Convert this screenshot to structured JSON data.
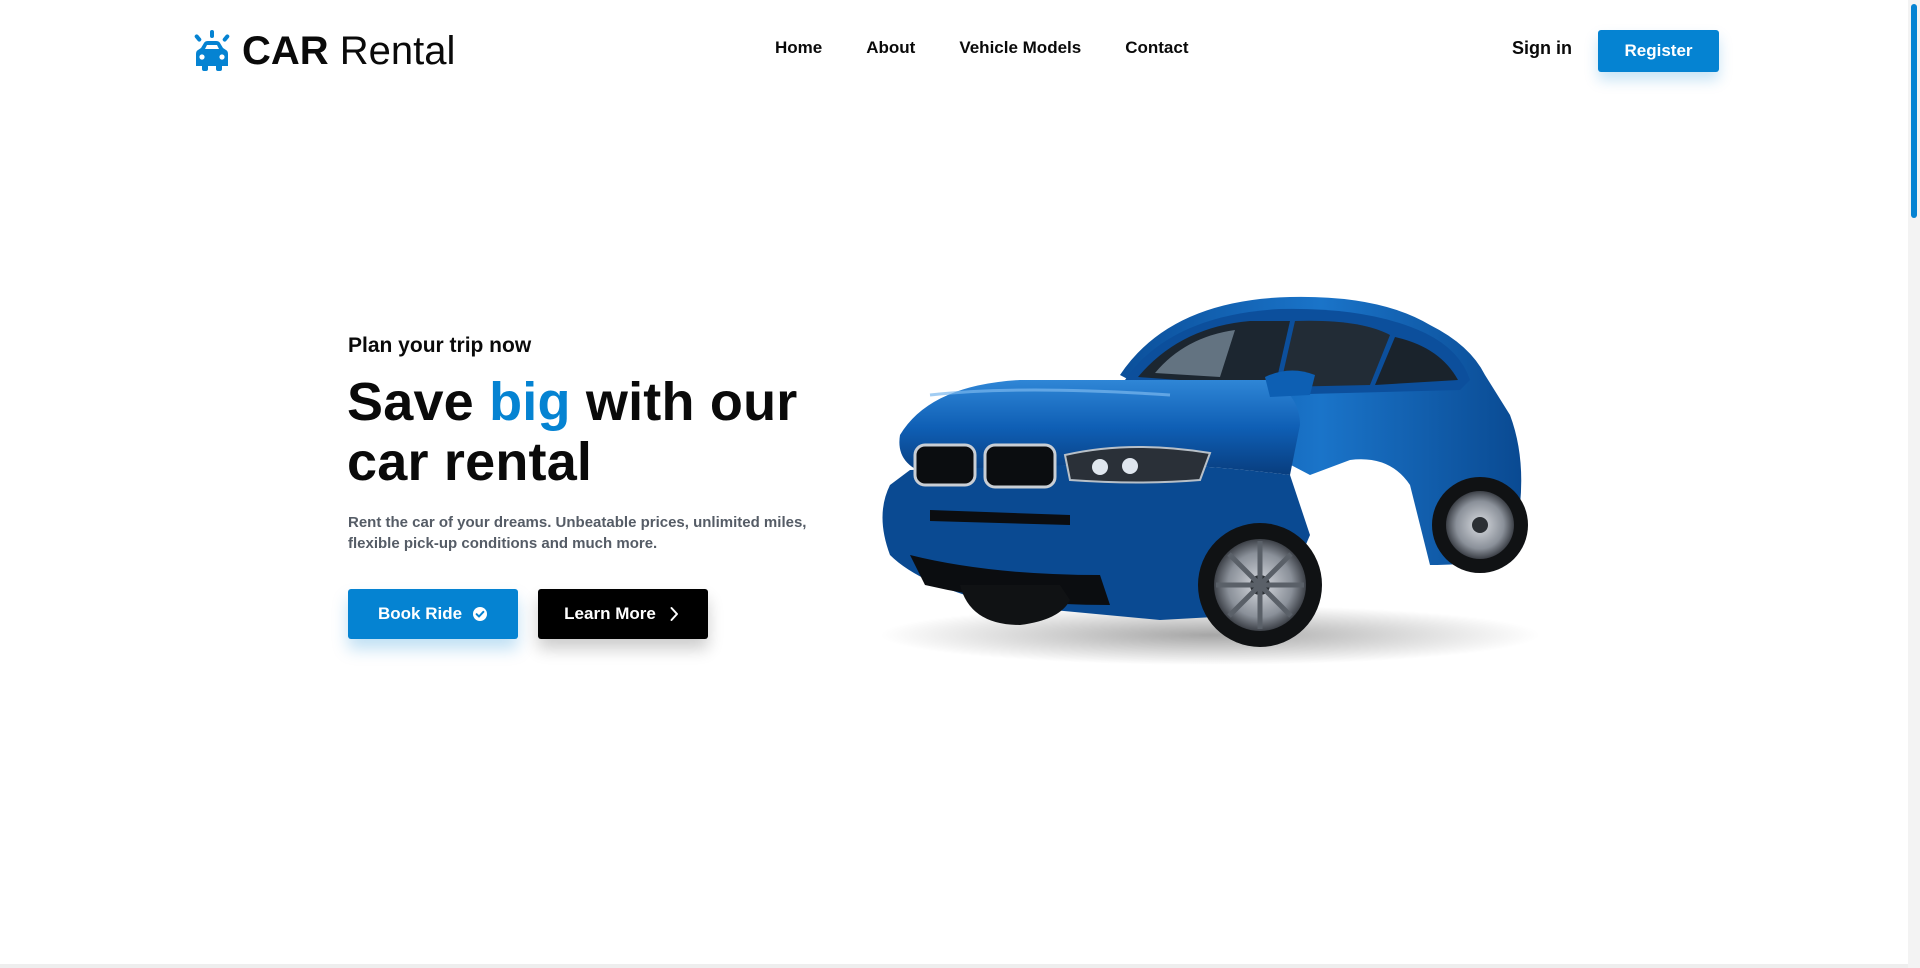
{
  "brand": {
    "strong": "CAR",
    "light": "Rental"
  },
  "nav": {
    "items": [
      {
        "label": "Home"
      },
      {
        "label": "About"
      },
      {
        "label": "Vehicle Models"
      },
      {
        "label": "Contact"
      }
    ]
  },
  "auth": {
    "signin": "Sign in",
    "register": "Register"
  },
  "hero": {
    "pretitle": "Plan your trip now",
    "title_before": "Save ",
    "title_accent": "big",
    "title_after": " with our car rental",
    "description": "Rent the car of your dreams. Unbeatable prices, unlimited miles, flexible pick-up conditions and much more.",
    "book_label": "Book Ride",
    "learn_label": "Learn More"
  },
  "colors": {
    "accent": "#0583d2",
    "dark": "#000000",
    "text": "#0a0a0a",
    "muted": "#555c66"
  },
  "icons": {
    "logo": "car-icon",
    "book": "check-circle-icon",
    "learn": "chevron-right-icon"
  }
}
